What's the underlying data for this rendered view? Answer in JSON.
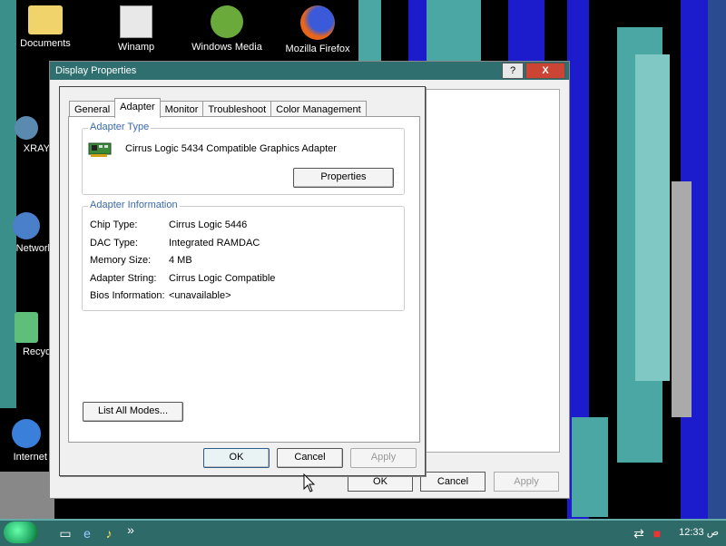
{
  "desktop": {
    "icons": [
      {
        "label": "Documents"
      },
      {
        "label": "Winamp"
      },
      {
        "label": "Windows Media"
      },
      {
        "label": "Mozilla Firefox"
      },
      {
        "label": "XRAYI"
      },
      {
        "label": "Network"
      },
      {
        "label": "Recycl"
      },
      {
        "label": "Internet I"
      }
    ]
  },
  "back_window": {
    "title": "Display Properties",
    "ok_label": "OK",
    "cancel_label": "Cancel",
    "apply_label": "Apply"
  },
  "window_buttons": {
    "help": "?",
    "close": "X"
  },
  "dialog": {
    "tabs": [
      {
        "label": "General"
      },
      {
        "label": "Adapter",
        "active": true
      },
      {
        "label": "Monitor"
      },
      {
        "label": "Troubleshoot"
      },
      {
        "label": "Color Management"
      }
    ],
    "adapter_type": {
      "title": "Adapter Type",
      "name": "Cirrus Logic 5434 Compatible Graphics Adapter",
      "properties_label": "Properties"
    },
    "adapter_info": {
      "title": "Adapter Information",
      "rows": [
        {
          "label": "Chip Type:",
          "value": "Cirrus Logic 5446"
        },
        {
          "label": "DAC Type:",
          "value": "Integrated RAMDAC"
        },
        {
          "label": "Memory Size:",
          "value": "4 MB"
        },
        {
          "label": "Adapter String:",
          "value": "Cirrus Logic Compatible"
        },
        {
          "label": "Bios Information:",
          "value": "<unavailable>"
        }
      ]
    },
    "list_modes_label": "List All Modes...",
    "ok_label": "OK",
    "cancel_label": "Cancel",
    "apply_label": "Apply"
  },
  "taskbar": {
    "chevron": "»",
    "clock": "12:33 ص"
  },
  "colors": {
    "desktop_bg": "#000000",
    "streak_teal": "#4aa7a3",
    "streak_blue": "#1c1ccc",
    "taskbar": "#2e6a68"
  }
}
